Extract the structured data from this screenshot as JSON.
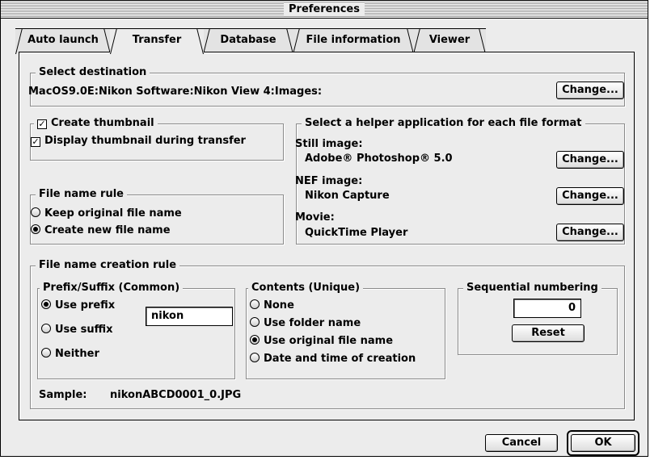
{
  "window": {
    "title": "Preferences"
  },
  "tabs": [
    {
      "label": "Auto launch",
      "active": false
    },
    {
      "label": "Transfer",
      "active": true
    },
    {
      "label": "Database",
      "active": false
    },
    {
      "label": "File information",
      "active": false
    },
    {
      "label": "Viewer",
      "active": false
    }
  ],
  "select_destination": {
    "legend": "Select destination",
    "path": "MacOS9.0E:Nikon Software:Nikon View 4:Images:",
    "change_label": "Change..."
  },
  "thumbnail": {
    "create_label": "Create thumbnail",
    "create_checked": true,
    "display_label": "Display thumbnail during transfer",
    "display_checked": true
  },
  "file_name_rule": {
    "legend": "File name rule",
    "options": [
      {
        "label": "Keep original file name",
        "selected": false
      },
      {
        "label": "Create new file name",
        "selected": true
      }
    ]
  },
  "helper_apps": {
    "legend": "Select a helper application for each file format",
    "still": {
      "label": "Still image:",
      "app": "Adobe® Photoshop® 5.0",
      "change_label": "Change..."
    },
    "nef": {
      "label": "NEF image:",
      "app": "Nikon Capture",
      "change_label": "Change..."
    },
    "movie": {
      "label": "Movie:",
      "app": "QuickTime Player",
      "change_label": "Change..."
    }
  },
  "creation_rule": {
    "legend": "File name creation rule",
    "prefix_suffix": {
      "legend": "Prefix/Suffix (Common)",
      "options": [
        {
          "label": "Use prefix",
          "selected": true
        },
        {
          "label": "Use suffix",
          "selected": false
        },
        {
          "label": "Neither",
          "selected": false
        }
      ],
      "value": "nikon"
    },
    "contents": {
      "legend": "Contents (Unique)",
      "options": [
        {
          "label": "None",
          "selected": false
        },
        {
          "label": "Use folder name",
          "selected": false
        },
        {
          "label": "Use original file name",
          "selected": true
        },
        {
          "label": "Date and time of creation",
          "selected": false
        }
      ]
    },
    "sequential": {
      "legend": "Sequential numbering",
      "value": "0",
      "reset_label": "Reset"
    },
    "sample_label": "Sample:",
    "sample_value": "nikonABCD0001_0.JPG"
  },
  "footer": {
    "cancel_label": "Cancel",
    "ok_label": "OK"
  }
}
